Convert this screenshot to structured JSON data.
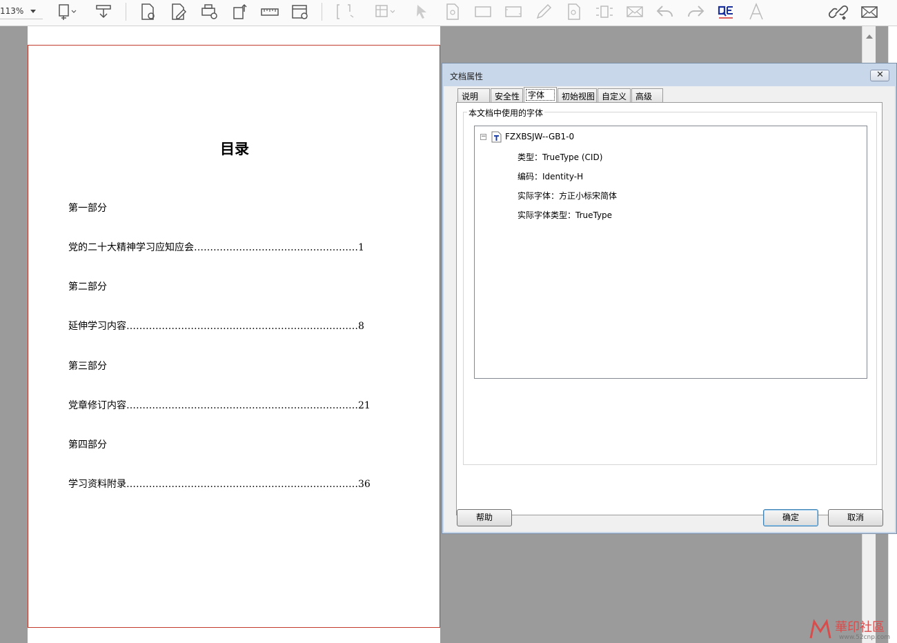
{
  "toolbar": {
    "zoom": "113%"
  },
  "document": {
    "toc_title": "目录",
    "toc_lines": [
      "第一部分",
      "党的二十大精神学习应知应会……………………………………………1",
      "第二部分",
      "延伸学习内容………………………………………………………………8",
      "第三部分",
      "党章修订内容………………………………………………………………21",
      "第四部分",
      "学习资料附录………………………………………………………………36"
    ]
  },
  "dialog": {
    "title": "文档属性",
    "close": "✕",
    "tabs": [
      "说明",
      "安全性",
      "字体",
      "初始视图",
      "自定义",
      "高级"
    ],
    "active_tab": "字体",
    "group_label": "本文档中使用的字体",
    "font": {
      "expander": "−",
      "name": "FZXBSJW--GB1-0",
      "type": "类型：TrueType (CID)",
      "encoding": "编码：Identity-H",
      "actual_font": "实际字体：方正小标宋简体",
      "actual_type": "实际字体类型：TrueType"
    },
    "buttons": {
      "help": "帮助",
      "ok": "确定",
      "cancel": "取消"
    }
  },
  "watermark": {
    "text": "華印社區",
    "url": "www.52cnp.com"
  },
  "colors": {
    "page_border": "#c0392b",
    "dialog_frame": "#c8d7ea",
    "workspace": "#9b9b9b"
  }
}
